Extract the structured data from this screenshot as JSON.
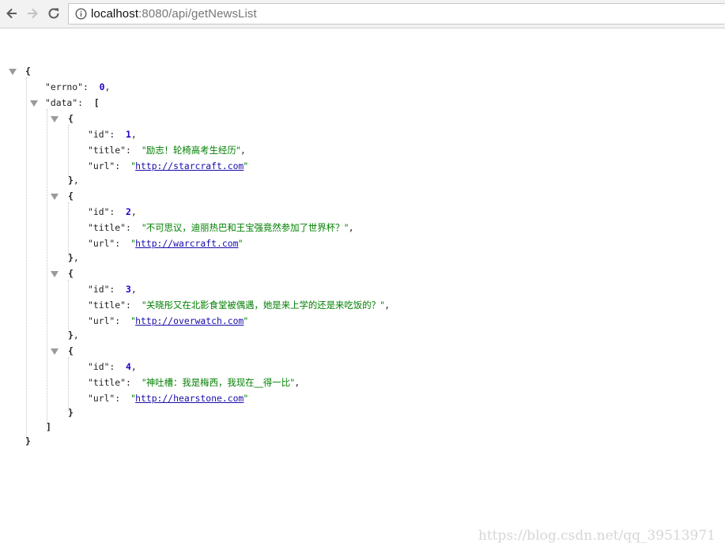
{
  "browser": {
    "url_host": "localhost",
    "url_rest": ":8080/api/getNewsList"
  },
  "json": {
    "errno_key": "errno",
    "errno_value": "0",
    "data_key": "data",
    "items": [
      {
        "id": "1",
        "title": "励志！轮椅高考生经历",
        "url": "http://starcraft.com"
      },
      {
        "id": "2",
        "title": "不可思议，迪丽热巴和王宝强竟然参加了世界杯？",
        "url": "http://warcraft.com"
      },
      {
        "id": "3",
        "title": "关晓彤又在北影食堂被偶遇，她是来上学的还是来吃饭的？",
        "url": "http://overwatch.com"
      },
      {
        "id": "4",
        "title": "神吐槽：我是梅西，我现在__得一比",
        "url": "http://hearstone.com"
      }
    ]
  },
  "watermark": "https://blog.csdn.net/qq_39513971"
}
